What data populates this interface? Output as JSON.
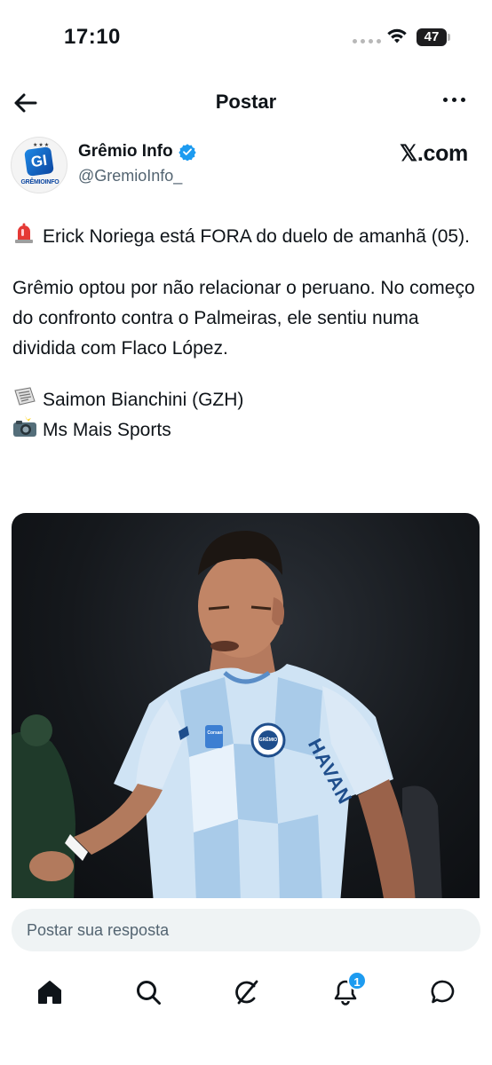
{
  "status_bar": {
    "time": "17:10",
    "battery": "47"
  },
  "header": {
    "title": "Postar",
    "back_icon": "arrow-left-icon",
    "more_icon": "more-horizontal-icon"
  },
  "author": {
    "name": "Grêmio Info",
    "handle": "@GremioInfo_",
    "verified": true,
    "avatar_text": "GRÊMIOINFO",
    "avatar_mark": "GI",
    "source": "𝕏.com"
  },
  "tweet": {
    "line1_emoji": "siren-emoji",
    "line1": "Erick Noriega está FORA do duelo de amanhã (05).",
    "paragraph2": "Grêmio optou por não relacionar o peruano. No começo do confronto contra o Palmeiras, ele sentiu numa dividida com Flaco López.",
    "credit1_emoji": "newspaper-emoji",
    "credit1": "Saimon Bianchini (GZH)",
    "credit2_emoji": "camera-flash-emoji",
    "credit2": "Ms Mais Sports"
  },
  "media": {
    "jersey_sponsor": "HAVAN",
    "jersey_brand": "Corsan",
    "crest_text": "GRÊMIO"
  },
  "reply": {
    "placeholder": "Postar sua resposta"
  },
  "tab_bar": {
    "tabs": [
      {
        "name": "home-icon"
      },
      {
        "name": "search-icon"
      },
      {
        "name": "grok-icon"
      },
      {
        "name": "bell-icon",
        "badge": "1"
      },
      {
        "name": "chat-bubble-icon"
      }
    ]
  },
  "colors": {
    "accent": "#1d9bf0",
    "text_primary": "#0f1419",
    "text_secondary": "#536471",
    "input_bg": "#eff3f4"
  }
}
